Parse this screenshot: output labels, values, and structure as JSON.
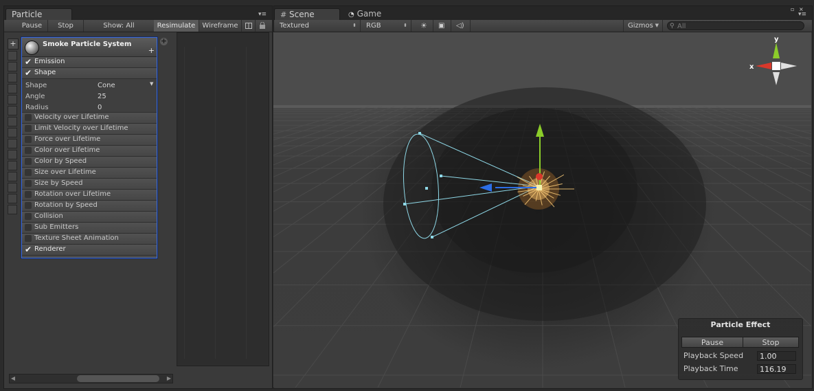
{
  "left_panel": {
    "tab_title": "Particle Effect",
    "toolbar": {
      "pause": "Pause",
      "stop": "Stop",
      "show": "Show: All",
      "resimulate": "Resimulate",
      "wireframe": "Wireframe"
    },
    "particle_system": {
      "name": "Smoke Particle System",
      "modules": [
        {
          "label": "Emission",
          "enabled": true
        },
        {
          "label": "Shape",
          "enabled": true
        }
      ],
      "shape_props": [
        {
          "label": "Shape",
          "value": "Cone"
        },
        {
          "label": "Angle",
          "value": "25"
        },
        {
          "label": "Radius",
          "value": "0"
        }
      ],
      "more_modules": [
        {
          "label": "Velocity over Lifetime",
          "enabled": false
        },
        {
          "label": "Limit Velocity over Lifetime",
          "enabled": false
        },
        {
          "label": "Force over Lifetime",
          "enabled": false
        },
        {
          "label": "Color over Lifetime",
          "enabled": false
        },
        {
          "label": "Color by Speed",
          "enabled": false
        },
        {
          "label": "Size over Lifetime",
          "enabled": false
        },
        {
          "label": "Size by Speed",
          "enabled": false
        },
        {
          "label": "Rotation over Lifetime",
          "enabled": false
        },
        {
          "label": "Rotation by Speed",
          "enabled": false
        },
        {
          "label": "Collision",
          "enabled": false
        },
        {
          "label": "Sub Emitters",
          "enabled": false
        },
        {
          "label": "Texture Sheet Animation",
          "enabled": false
        },
        {
          "label": "Renderer",
          "enabled": true
        }
      ]
    }
  },
  "scene_panel": {
    "tabs": [
      {
        "label": "Scene",
        "icon": "grid-icon"
      },
      {
        "label": "Game",
        "icon": "pacman-icon"
      }
    ],
    "toolbar": {
      "render_mode": "Textured",
      "channel": "RGB",
      "gizmos": "Gizmos",
      "search_placeholder": "All"
    },
    "gizmo_axes": {
      "x": "x",
      "y": "y"
    },
    "overlay": {
      "title": "Particle Effect",
      "pause": "Pause",
      "stop": "Stop",
      "playback_speed_label": "Playback Speed",
      "playback_speed": "1.00",
      "playback_time_label": "Playback Time",
      "playback_time": "116.19"
    }
  },
  "colors": {
    "selection_border": "#3c6bd8",
    "gizmo_x": "#d8382b",
    "gizmo_y": "#8ccd2a",
    "gizmo_z": "#2c6ee6",
    "cone_wire": "#8fd9e8"
  }
}
